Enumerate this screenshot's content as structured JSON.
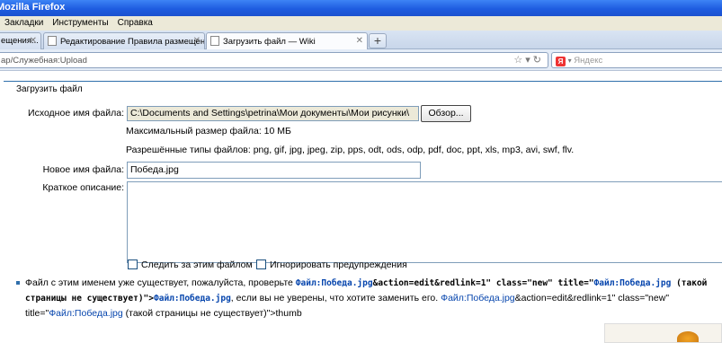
{
  "window": {
    "title": "Mozilla Firefox"
  },
  "menu": {
    "items": [
      {
        "label": "Закладки"
      },
      {
        "label": "Инструменты"
      },
      {
        "label": "Справка"
      }
    ]
  },
  "tabs": [
    {
      "label": "ещения...",
      "active": false
    },
    {
      "label": "Редактирование Правила размещения...",
      "active": false
    },
    {
      "label": "Загрузить файл — Wiki",
      "active": true
    }
  ],
  "nav": {
    "url": "ар/Служебная:Upload",
    "search_placeholder": "Яндекс",
    "search_logo": "Я"
  },
  "upload_form": {
    "legend": "Загрузить файл",
    "source_label": "Исходное имя файла:",
    "source_value": "C:\\Documents and Settings\\petrina\\Мои документы\\Мои рисунки\\",
    "browse_label": "Обзор...",
    "max_size": "Максимальный размер файла: 10 МБ",
    "allowed_types": "Разрешённые типы файлов: png, gif, jpg, jpeg, zip, pps, odt, ods, odp, pdf, doc, ppt, xls, mp3, avi, swf, flv.",
    "new_name_label": "Новое имя файла:",
    "new_name_value": "Победа.jpg",
    "description_label": "Краткое описание:",
    "watch_label": "Следить за этим файлом",
    "ignore_label": "Игнорировать предупреждения"
  },
  "warning": {
    "t1": "Файл с этим именем уже существует, пожалуйста, проверьте ",
    "m1": "Файл:Победа.jpg",
    "m2": "&action=edit&redlink=1\" class=\"new\" title=\"",
    "m3": "Файл:Победа.jpg",
    "m4": " (такой страницы не существует)\">",
    "m5": "Файл:Победа.jpg",
    "t2": ", если вы не уверены, что хотите заменить его. ",
    "l1": "Файл:Победа.jpg",
    "t3": "&action=edit&redlink=1\" class=\"new\" title=\"",
    "l2": "Файл:Победа.jpg",
    "t4": " (такой страницы не существует)\">thumb"
  }
}
